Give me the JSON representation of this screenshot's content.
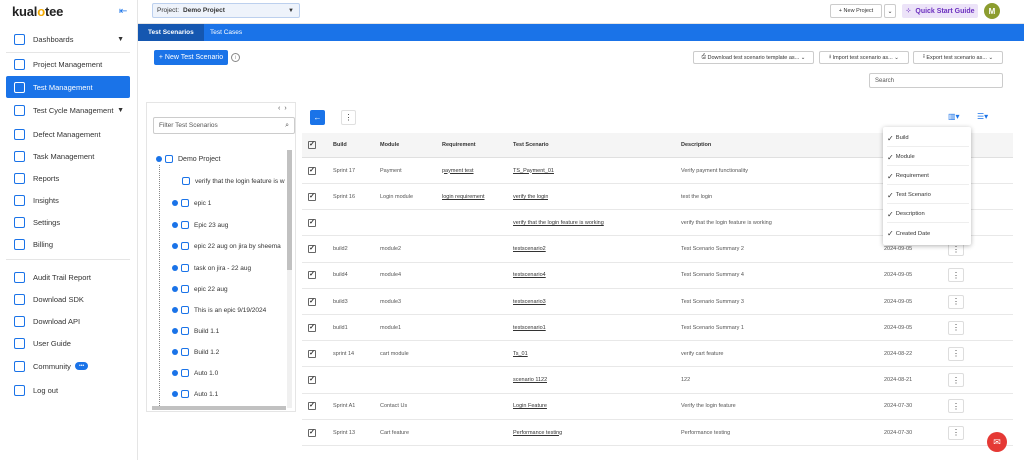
{
  "app": {
    "logo_prefix": "kual",
    "logo_o": "o",
    "logo_suffix": "tee"
  },
  "sidebar": {
    "items": [
      {
        "label": "Dashboards"
      },
      {
        "label": "Project Management"
      },
      {
        "label": "Test Management"
      },
      {
        "label": "Test Cycle Management"
      },
      {
        "label": "Defect Management"
      },
      {
        "label": "Task Management"
      },
      {
        "label": "Reports"
      },
      {
        "label": "Insights"
      },
      {
        "label": "Settings"
      },
      {
        "label": "Billing"
      },
      {
        "label": "Audit Trail Report"
      },
      {
        "label": "Download SDK"
      },
      {
        "label": "Download API"
      },
      {
        "label": "User Guide"
      },
      {
        "label": "Community"
      },
      {
        "label": "Log out"
      }
    ]
  },
  "topbar": {
    "project_label": "Project:",
    "project_value": "Demo Project",
    "new_project": "+ New Project",
    "quick_start": "Quick Start Guide",
    "avatar_initial": "M"
  },
  "tabs": [
    {
      "label": "Test Scenarios"
    },
    {
      "label": "Test Cases"
    }
  ],
  "toolbar": {
    "new_scenario": "+ New Test Scenario",
    "download_template": "Download test scenario template as...",
    "import": "Import test scenario as...",
    "export": "Export test scenario as...",
    "search_placeholder": "Search"
  },
  "tree": {
    "filter_placeholder": "Filter Test Scenarios",
    "root": "Demo Project",
    "nodes": [
      "verify that the login feature is w",
      "epic 1",
      "Epic 23 aug",
      "epic 22 aug on jira by sheema",
      "task on jira - 22 aug",
      "epic 22 aug",
      "This is an epic 9/19/2024",
      "Build 1.1",
      "Build 1.2",
      "Auto 1.0",
      "Auto 1.1"
    ]
  },
  "grid": {
    "headers": {
      "build": "Build",
      "module": "Module",
      "requirement": "Requirement",
      "scenario": "Test Scenario",
      "description": "Description"
    },
    "rows": [
      {
        "build": "Sprint 17",
        "module": "Payment",
        "requirement": "payment test",
        "scenario": "TS_Payment_01",
        "description": "Verify payment functionality",
        "date": ""
      },
      {
        "build": "Sprint 16",
        "module": "Login module",
        "requirement": "login requirement",
        "scenario": "verify the login",
        "description": "test the login",
        "date": ""
      },
      {
        "build": "",
        "module": "",
        "requirement": "",
        "scenario": "verify that the login feature is working",
        "description": "verify that the login feature is working",
        "date": ""
      },
      {
        "build": "build2",
        "module": "module2",
        "requirement": "",
        "scenario": "testscenario2",
        "description": "Test Scenario Summary 2",
        "date": "2024-09-05"
      },
      {
        "build": "build4",
        "module": "module4",
        "requirement": "",
        "scenario": "testscenario4",
        "description": "Test Scenario Summary 4",
        "date": "2024-09-05"
      },
      {
        "build": "build3",
        "module": "module3",
        "requirement": "",
        "scenario": "testscenario3",
        "description": "Test Scenario Summary 3",
        "date": "2024-09-05"
      },
      {
        "build": "build1",
        "module": "module1",
        "requirement": "",
        "scenario": "testscenario1",
        "description": "Test Scenario Summary 1",
        "date": "2024-09-05"
      },
      {
        "build": "sprint 14",
        "module": "cart module",
        "requirement": "",
        "scenario": "Ts_01",
        "description": "verify cart feature",
        "date": "2024-08-22"
      },
      {
        "build": "",
        "module": "",
        "requirement": "",
        "scenario": "scenario 1122",
        "description": "122",
        "date": "2024-08-21"
      },
      {
        "build": "Sprint A1",
        "module": "Contact Us",
        "requirement": "",
        "scenario": "Login Feature",
        "description": "Verify the login feature",
        "date": "2024-07-30"
      },
      {
        "build": "Sprint 13",
        "module": "Cart feature",
        "requirement": "",
        "scenario": "Performance testing",
        "description": "Performance testing",
        "date": "2024-07-30"
      }
    ]
  },
  "column_menu": {
    "options": [
      "Build",
      "Module",
      "Requirement",
      "Test Scenario",
      "Description",
      "Created Date"
    ]
  },
  "colors": {
    "primary": "#1a73e8",
    "accent_purple": "#6b2fbf",
    "chat": "#e53935"
  }
}
